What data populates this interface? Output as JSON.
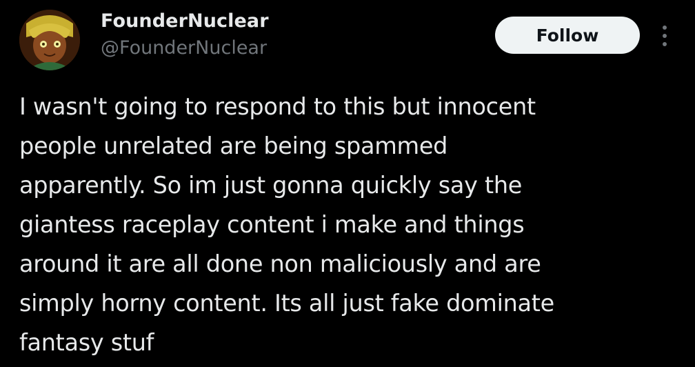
{
  "author": {
    "display_name": "FounderNuclear",
    "handle": "@FounderNuclear",
    "avatar_icon": "character-avatar"
  },
  "actions": {
    "follow_label": "Follow",
    "more_icon": "more-options-icon"
  },
  "tweet": {
    "text": "I wasn't going to respond to this but innocent\npeople unrelated are being spammed\napparently. So im just gonna quickly say the\ngiantess raceplay content i make and things\naround it are all done non maliciously and are\nsimply horny content. Its all just fake dominate\nfantasy stuf"
  },
  "colors": {
    "background": "#000000",
    "text_primary": "#e7e9ea",
    "text_secondary": "#71767b",
    "follow_bg": "#eff3f4",
    "follow_text": "#0f1419"
  }
}
